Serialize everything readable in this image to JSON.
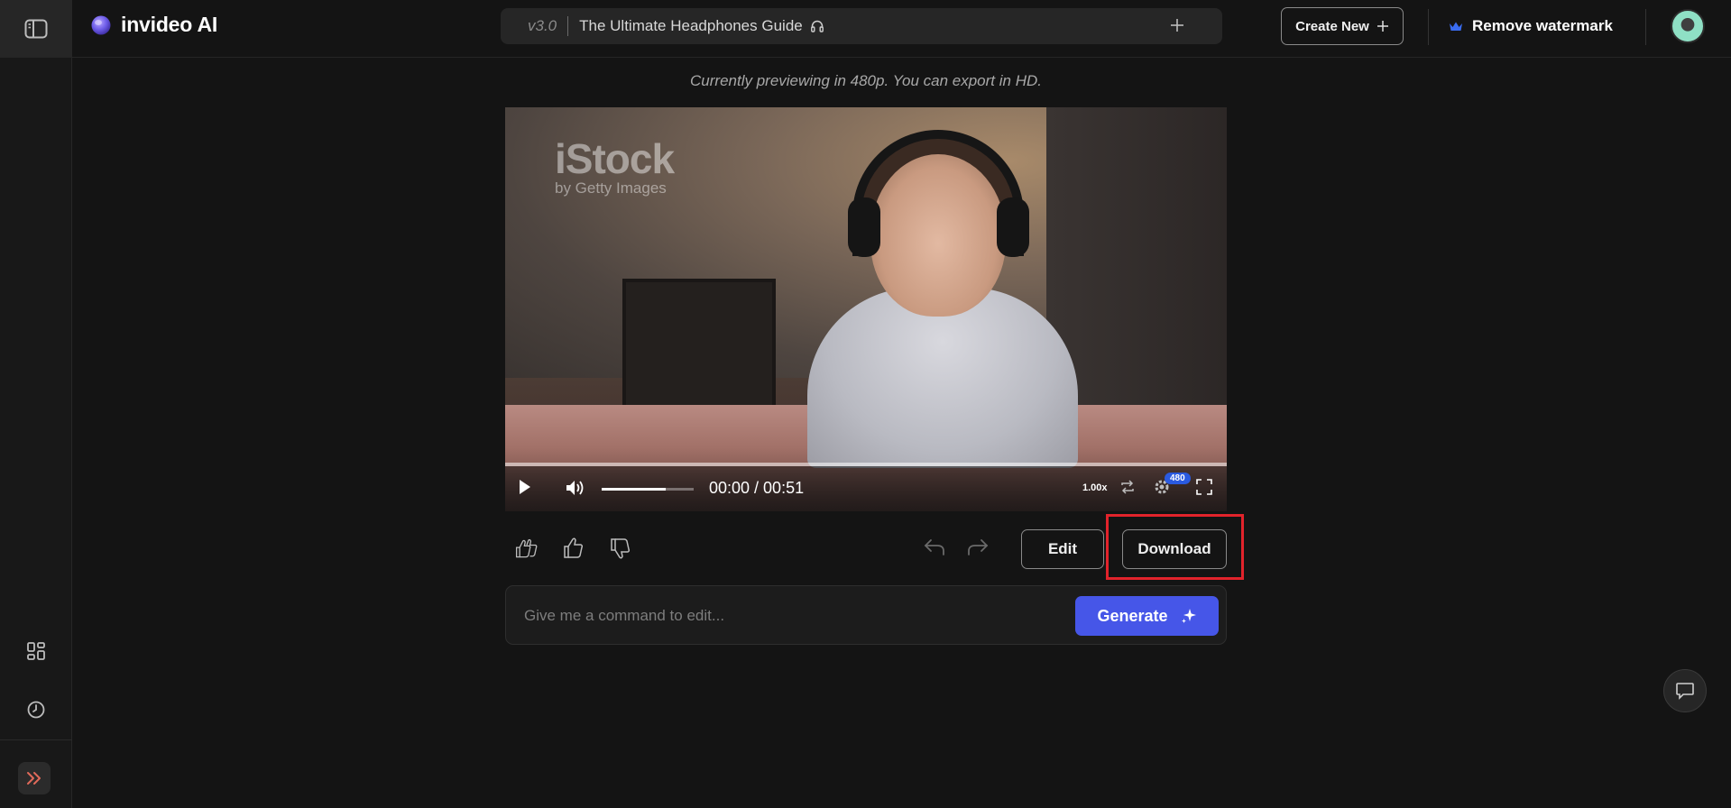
{
  "app": {
    "brand_name": "invideo AI",
    "accent_color": "#4656e8",
    "crown_color": "#3a6cf0",
    "highlight_color": "#e2232b"
  },
  "header": {
    "version": "v3.0",
    "project_title": "The Ultimate Headphones Guide",
    "title_icon": "headphones-icon",
    "create_new_label": "Create New",
    "remove_watermark_label": "Remove watermark"
  },
  "preview": {
    "note": "Currently previewing in 480p. You can export in HD.",
    "watermark_main": "iStock",
    "watermark_sub": "by Getty Images"
  },
  "player": {
    "time_display": "00:00 / 00:51",
    "speed": "1.00x",
    "resolution_badge": "480",
    "volume_level": 0.7,
    "progress": 0
  },
  "actions": {
    "edit_label": "Edit",
    "download_label": "Download"
  },
  "command": {
    "placeholder": "Give me a command to edit...",
    "value": "",
    "generate_label": "Generate"
  },
  "sidebar": {
    "icons": [
      "sidebar-toggle-icon",
      "grid-icon",
      "history-icon",
      "expand-icon"
    ]
  }
}
